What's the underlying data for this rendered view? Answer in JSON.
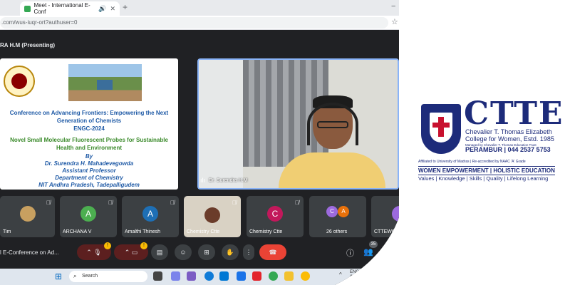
{
  "browser": {
    "tab_title": "Meet - International E-Conf",
    "url": ".com/wus-iuqr-ort?authuser=0"
  },
  "meet": {
    "presenting_label": "RA H.M (Presenting)",
    "slide": {
      "line1": "Conference on Advancing Frontiers: Empowering the Next",
      "line2": "Generation of Chemists",
      "line3": "ENGC-2024",
      "line4": "Novel Small Molecular Fluorescent Probes for Sustainable",
      "line5": "Health and Environment",
      "line6": "By",
      "line7": "Dr. Surendra H. Mahadevegowda",
      "line8": "Assistant Professor",
      "line9": "Department of Chemistry",
      "line10": "NIT Andhra Pradesh, Tadepalligudem"
    },
    "speaker_name": "Dr. Surendra H.M",
    "participants": [
      {
        "name": "Tim",
        "initial": "",
        "color": "#c8a060"
      },
      {
        "name": "ARCHANA V",
        "initial": "A",
        "color": "#4caf50"
      },
      {
        "name": "Amalthi Thinesh",
        "initial": "A",
        "color": "#1e6fb5"
      },
      {
        "name": "Chemistry Ctte",
        "initial": "",
        "color": "#e8e0d0"
      },
      {
        "name": "Chemistry Ctte",
        "initial": "C",
        "color": "#c2185b"
      },
      {
        "name": "26 others",
        "initial": "C",
        "color": "#9c6ade"
      },
      {
        "name": "CTTEWO",
        "initial": "",
        "color": "#9c6ade"
      }
    ],
    "others_second_initial": "A",
    "meeting_name": "l E-Conference on Ad...",
    "participant_count": "35",
    "badge_1": "!",
    "badge_2": "!"
  },
  "taskbar": {
    "search_placeholder": "Search",
    "lang": "ENG",
    "lang2": "IN"
  },
  "logo": {
    "big": "CTTE",
    "line1": "Chevalier T. Thomas Elizabeth",
    "line2": "College for Women, Estd. 1985",
    "managed": "Managed by Chevalier T. Thomas Education Trust",
    "place": "PERAMBUR | 044 2537 5753",
    "affil": "Affiliated to University of Madras | Re-accredited by NAAC 'A' Grade",
    "tagline": "WOMEN EMPOWERMENT | HOLISTIC EDUCATION",
    "values": "Values | Knowledge | Skills | Quality | Lifelong Learning"
  },
  "colors": {
    "meet_bg": "#202124",
    "tile": "#3c4043",
    "end_call": "#ea4335",
    "brand": "#1d2b7a"
  }
}
